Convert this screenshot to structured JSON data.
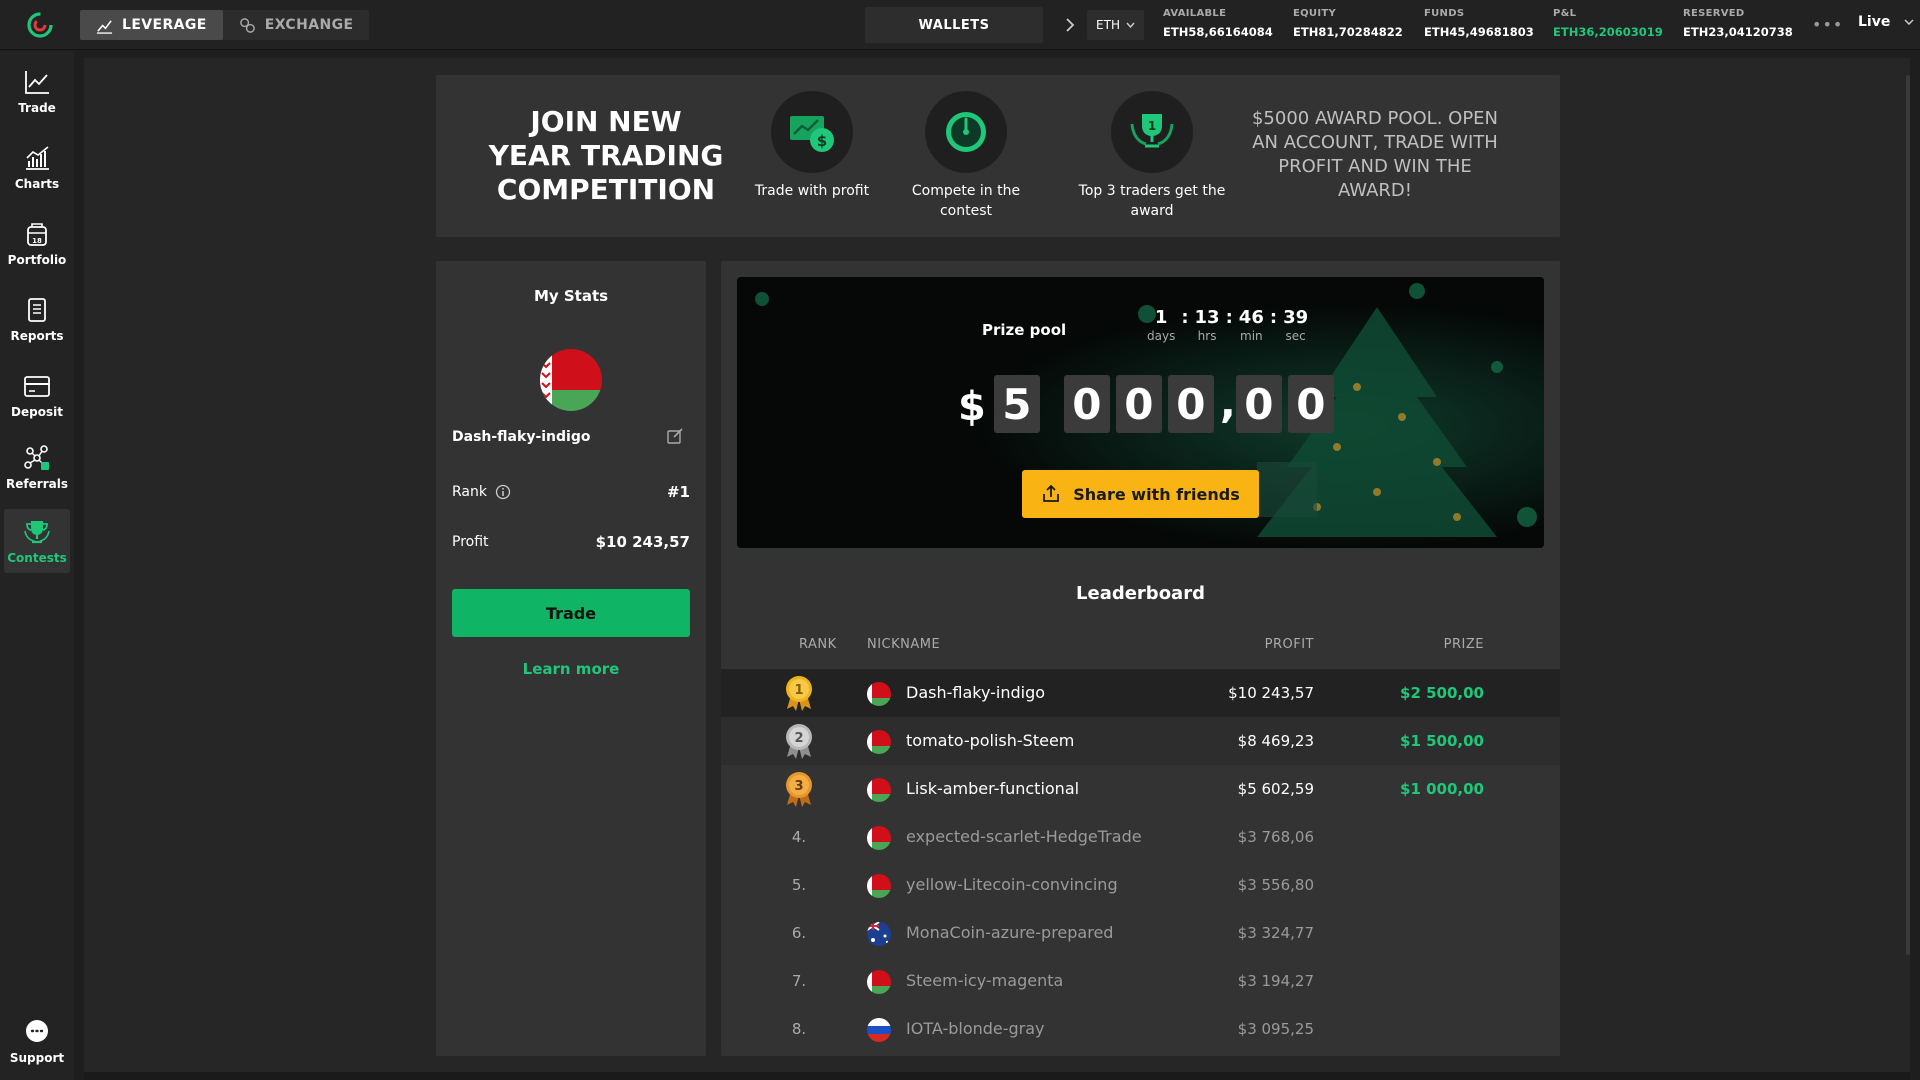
{
  "topbar": {
    "modes": [
      {
        "label": "LEVERAGE",
        "icon": "chart-line-icon",
        "active": true
      },
      {
        "label": "EXCHANGE",
        "icon": "exchange-icon",
        "active": false
      }
    ],
    "wallets_label": "WALLETS",
    "currency": "ETH",
    "stats": [
      {
        "label": "AVAILABLE",
        "value": "ETH58,66164084"
      },
      {
        "label": "EQUITY",
        "value": "ETH81,70284822"
      },
      {
        "label": "FUNDS",
        "value": "ETH45,49681803"
      },
      {
        "label": "P&L",
        "value": "ETH36,20603019",
        "color": "#1fc779"
      },
      {
        "label": "RESERVED",
        "value": "ETH23,04120738"
      }
    ],
    "more": "•••",
    "mode_select": "Live"
  },
  "sidebar": {
    "items": [
      {
        "label": "Trade",
        "icon": "trade-chart-icon"
      },
      {
        "label": "Charts",
        "icon": "charts-icon"
      },
      {
        "label": "Portfolio",
        "icon": "portfolio-icon",
        "badge": "18"
      },
      {
        "label": "Reports",
        "icon": "reports-icon"
      },
      {
        "label": "Deposit",
        "icon": "deposit-card-icon"
      },
      {
        "label": "Referrals",
        "icon": "referrals-icon"
      },
      {
        "label": "Contests",
        "icon": "trophy-icon",
        "active": true
      }
    ],
    "support_label": "Support"
  },
  "banner": {
    "title": "JOIN NEW YEAR TRADING COMPETITION",
    "steps": [
      {
        "text": "Trade with profit",
        "icon": "money-screen-icon"
      },
      {
        "text": "Compete in the contest",
        "icon": "stopwatch-icon"
      },
      {
        "text": "Top 3 traders get the award",
        "icon": "trophy-laurel-icon"
      }
    ],
    "award_text": "$5000 AWARD POOL. OPEN AN ACCOUNT, TRADE WITH PROFIT AND WIN THE AWARD!"
  },
  "my_stats": {
    "title": "My Stats",
    "nickname": "Dash-flaky-indigo",
    "rank_label": "Rank",
    "rank_value": "#1",
    "profit_label": "Profit",
    "profit_value": "$10 243,57",
    "trade_button": "Trade",
    "learn_more": "Learn more"
  },
  "prize_pool": {
    "label": "Prize pool",
    "countdown": [
      {
        "value": "1",
        "unit": "days"
      },
      {
        "value": "13",
        "unit": "hrs"
      },
      {
        "value": "46",
        "unit": "min"
      },
      {
        "value": "39",
        "unit": "sec"
      }
    ],
    "currency_symbol": "$",
    "digits": [
      "5",
      "0",
      "0",
      "0",
      "0",
      "0"
    ],
    "share_button": "Share with friends"
  },
  "leaderboard": {
    "title": "Leaderboard",
    "columns": {
      "rank": "RANK",
      "nickname": "NICKNAME",
      "profit": "PROFIT",
      "prize": "PRIZE"
    },
    "rows": [
      {
        "rank": "1",
        "nickname": "Dash-flaky-indigo",
        "flag": "belarus",
        "profit": "$10 243,57",
        "prize": "$2 500,00"
      },
      {
        "rank": "2",
        "nickname": "tomato-polish-Steem",
        "flag": "belarus",
        "profit": "$8 469,23",
        "prize": "$1 500,00"
      },
      {
        "rank": "3",
        "nickname": "Lisk-amber-functional",
        "flag": "belarus",
        "profit": "$5 602,59",
        "prize": "$1 000,00"
      },
      {
        "rank": "4.",
        "nickname": "expected-scarlet-HedgeTrade",
        "flag": "belarus",
        "profit": "$3 768,06",
        "prize": ""
      },
      {
        "rank": "5.",
        "nickname": "yellow-Litecoin-convincing",
        "flag": "belarus",
        "profit": "$3 556,80",
        "prize": ""
      },
      {
        "rank": "6.",
        "nickname": "MonaCoin-azure-prepared",
        "flag": "australia",
        "profit": "$3 324,77",
        "prize": ""
      },
      {
        "rank": "7.",
        "nickname": "Steem-icy-magenta",
        "flag": "belarus",
        "profit": "$3 194,27",
        "prize": ""
      },
      {
        "rank": "8.",
        "nickname": "IOTA-blonde-gray",
        "flag": "russia",
        "profit": "$3 095,25",
        "prize": ""
      }
    ]
  },
  "colors": {
    "accent_green": "#1fc779",
    "button_green": "#0fb565",
    "share_yellow": "#f9b414",
    "gold": "#f2b21c",
    "silver": "#b8b8b8",
    "bronze": "#e8962a"
  }
}
